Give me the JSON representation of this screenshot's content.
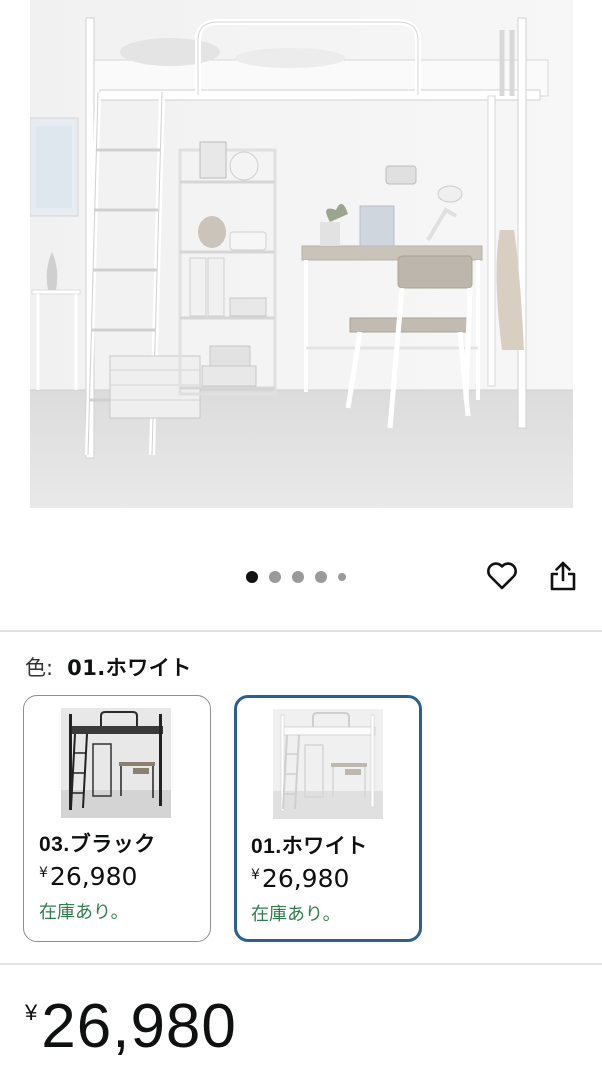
{
  "carousel": {
    "dot_count": 5,
    "active_index": 0,
    "favorite_icon": "heart-icon",
    "share_icon": "share-icon"
  },
  "color_selector": {
    "label": "色:",
    "selected_value": "01.ホワイト"
  },
  "swatches": [
    {
      "name": "03.ブラック",
      "currency": "¥",
      "price": "26,980",
      "stock": "在庫あり。",
      "selected": false
    },
    {
      "name": "01.ホワイト",
      "currency": "¥",
      "price": "26,980",
      "stock": "在庫あり。",
      "selected": true
    }
  ],
  "price": {
    "currency": "¥",
    "amount": "26,980"
  },
  "colors": {
    "selected_border": "#2e5f8a",
    "in_stock": "#2f7d4a"
  }
}
